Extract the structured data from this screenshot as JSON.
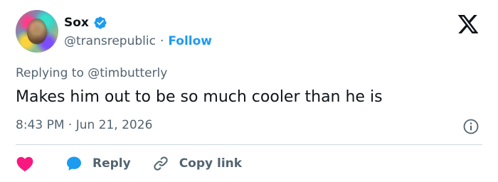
{
  "author": {
    "display_name": "Sox",
    "handle": "@transrepublic",
    "separator": "·",
    "follow_label": "Follow",
    "verified": true
  },
  "tweet": {
    "replying_prefix": "Replying to",
    "replying_to": "@timbutterly",
    "text": "Makes him out to be so much cooler than he is",
    "timestamp": "8:43 PM · Jun 21, 2026"
  },
  "actions": {
    "reply_label": "Reply",
    "copy_link_label": "Copy link"
  },
  "colors": {
    "accent": "#1d9bf0",
    "heart": "#f91880",
    "text_primary": "#0f1419",
    "text_secondary": "#536471",
    "divider": "#cfd9de"
  },
  "icons": {
    "brand": "x-logo-icon",
    "verified": "verified-badge-icon",
    "info": "info-icon",
    "like": "heart-icon",
    "reply": "reply-bubble-icon",
    "copy_link": "link-icon"
  }
}
